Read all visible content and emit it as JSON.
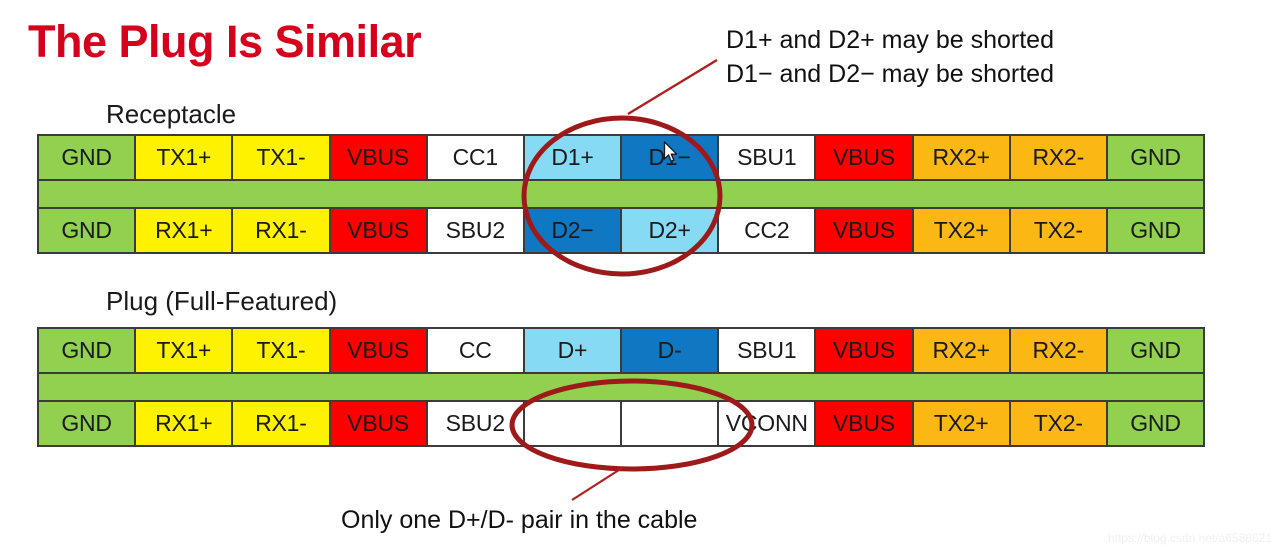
{
  "slide": {
    "title": "The Plug Is Similar",
    "title_color": "#d6001c",
    "watermark": "https://blog.csdn.net/a6588621"
  },
  "annotations": {
    "top": {
      "line1": "D1+ and D2+ may be shorted",
      "line2": "D1− and D2− may be shorted"
    },
    "bottom": {
      "line1": "Only one D+/D- pair in the cable"
    },
    "circle_color": "#9e1a1a"
  },
  "palette": {
    "green": "#92d050",
    "yellow": "#fff200",
    "red": "#fe0000",
    "white": "#ffffff",
    "light_blue": "#87daf4",
    "dark_blue": "#1077c3",
    "orange": "#fbb713"
  },
  "receptacle": {
    "label": "Receptacle",
    "top_row": [
      {
        "label": "GND",
        "color": "green"
      },
      {
        "label": "TX1+",
        "color": "yellow"
      },
      {
        "label": "TX1-",
        "color": "yellow"
      },
      {
        "label": "VBUS",
        "color": "red"
      },
      {
        "label": "CC1",
        "color": "white"
      },
      {
        "label": "D1+",
        "color": "light_blue"
      },
      {
        "label": "D1−",
        "color": "dark_blue"
      },
      {
        "label": "SBU1",
        "color": "white"
      },
      {
        "label": "VBUS",
        "color": "red"
      },
      {
        "label": "RX2+",
        "color": "orange"
      },
      {
        "label": "RX2-",
        "color": "orange"
      },
      {
        "label": "GND",
        "color": "green"
      }
    ],
    "bottom_row": [
      {
        "label": "GND",
        "color": "green"
      },
      {
        "label": "RX1+",
        "color": "yellow"
      },
      {
        "label": "RX1-",
        "color": "yellow"
      },
      {
        "label": "VBUS",
        "color": "red"
      },
      {
        "label": "SBU2",
        "color": "white"
      },
      {
        "label": "D2−",
        "color": "dark_blue"
      },
      {
        "label": "D2+",
        "color": "light_blue"
      },
      {
        "label": "CC2",
        "color": "white"
      },
      {
        "label": "VBUS",
        "color": "red"
      },
      {
        "label": "TX2+",
        "color": "orange"
      },
      {
        "label": "TX2-",
        "color": "orange"
      },
      {
        "label": "GND",
        "color": "green"
      }
    ]
  },
  "plug": {
    "label": "Plug (Full-Featured)",
    "top_row": [
      {
        "label": "GND",
        "color": "green"
      },
      {
        "label": "TX1+",
        "color": "yellow"
      },
      {
        "label": "TX1-",
        "color": "yellow"
      },
      {
        "label": "VBUS",
        "color": "red"
      },
      {
        "label": "CC",
        "color": "white"
      },
      {
        "label": "D+",
        "color": "light_blue"
      },
      {
        "label": "D-",
        "color": "dark_blue"
      },
      {
        "label": "SBU1",
        "color": "white"
      },
      {
        "label": "VBUS",
        "color": "red"
      },
      {
        "label": "RX2+",
        "color": "orange"
      },
      {
        "label": "RX2-",
        "color": "orange"
      },
      {
        "label": "GND",
        "color": "green"
      }
    ],
    "bottom_row": [
      {
        "label": "GND",
        "color": "green"
      },
      {
        "label": "RX1+",
        "color": "yellow"
      },
      {
        "label": "RX1-",
        "color": "yellow"
      },
      {
        "label": "VBUS",
        "color": "red"
      },
      {
        "label": "SBU2",
        "color": "white"
      },
      {
        "label": "",
        "color": "white"
      },
      {
        "label": "",
        "color": "white"
      },
      {
        "label": "VCONN",
        "color": "white"
      },
      {
        "label": "VBUS",
        "color": "red"
      },
      {
        "label": "TX2+",
        "color": "orange"
      },
      {
        "label": "TX2-",
        "color": "orange"
      },
      {
        "label": "GND",
        "color": "green"
      }
    ]
  },
  "cursor": {
    "icon": "mouse-pointer-icon"
  }
}
